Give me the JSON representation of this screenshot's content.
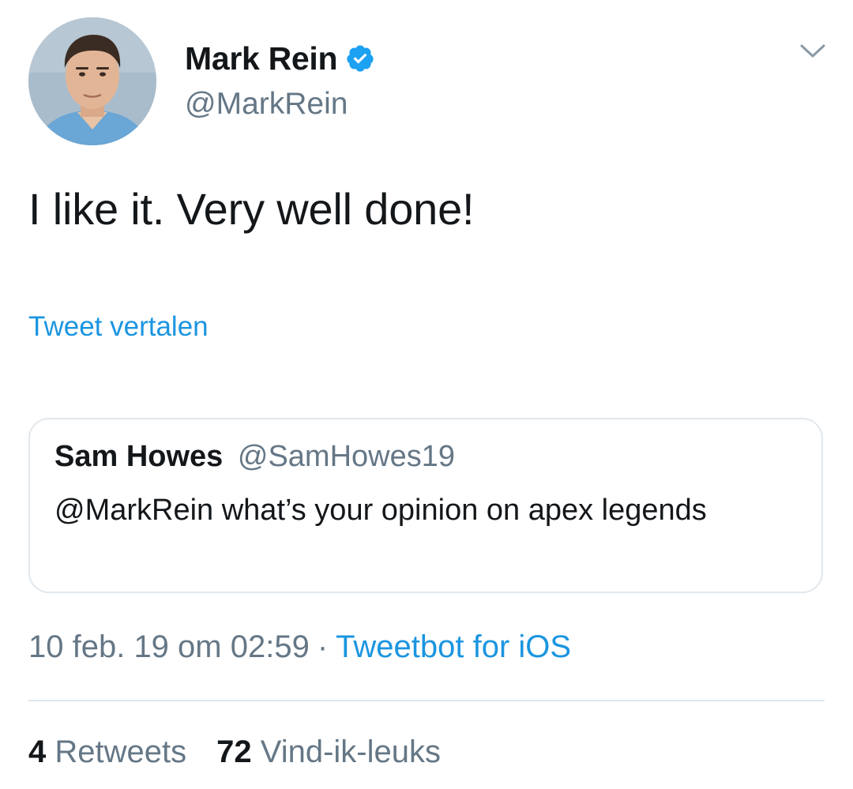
{
  "author": {
    "display_name": "Mark Rein",
    "handle": "@MarkRein",
    "verified": true,
    "avatar": "avatar"
  },
  "icons": {
    "verified": "verified-badge-icon",
    "menu": "chevron-down-icon"
  },
  "tweet": {
    "text": "I like it. Very well done!",
    "translate_label": "Tweet vertalen"
  },
  "quoted_tweet": {
    "display_name": "Sam Howes",
    "handle": "@SamHowes19",
    "text": "@MarkRein what’s your opinion on apex legends"
  },
  "meta": {
    "timestamp": "10 feb. 19 om 02:59",
    "separator": "·",
    "source": "Tweetbot for iOS"
  },
  "stats": {
    "retweets_count": "4",
    "retweets_label": "Retweets",
    "likes_count": "72",
    "likes_label": "Vind-ik-leuks"
  },
  "colors": {
    "link": "#1b95e0",
    "secondary_text": "#657786",
    "primary_text": "#14171a",
    "border": "#e1e8ed",
    "verified": "#1da1f2"
  }
}
